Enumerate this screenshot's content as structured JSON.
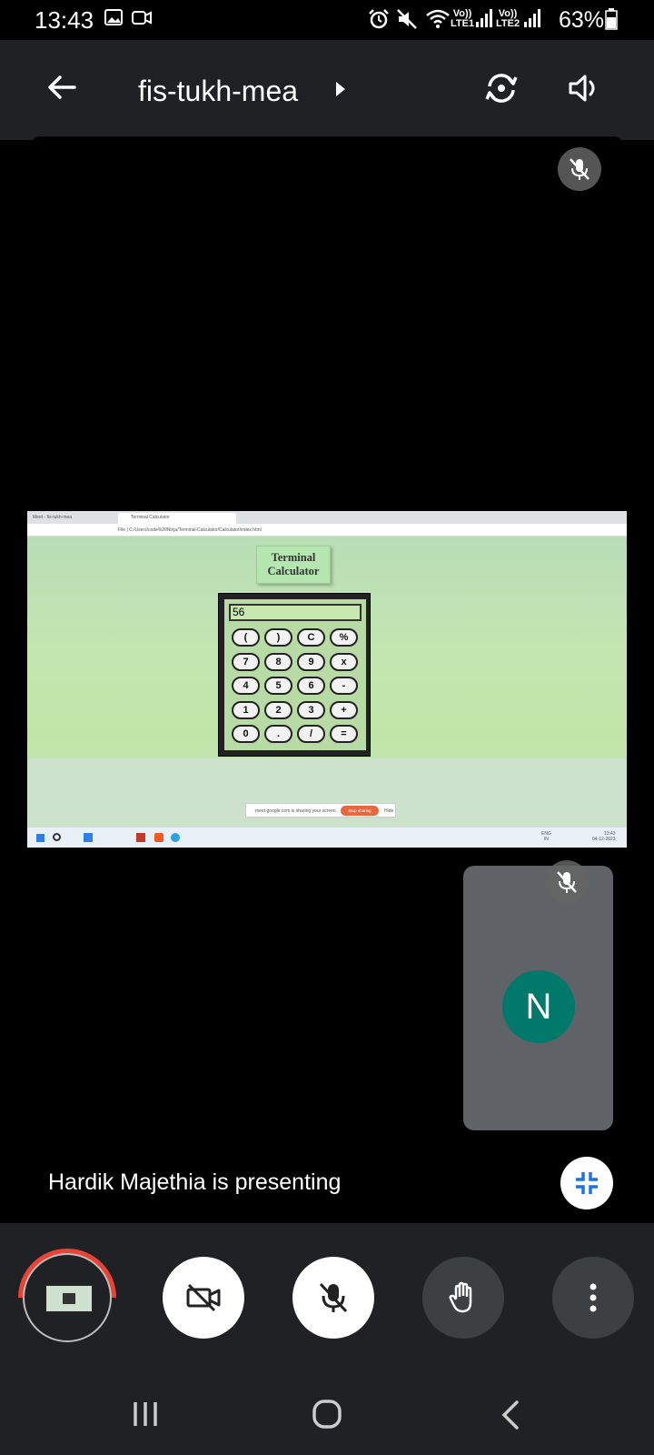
{
  "status_bar": {
    "time": "13:43",
    "battery": "63%",
    "sim1_label": "Vo))\nLTE1",
    "sim2_label": "Vo))\nLTE2",
    "icons": [
      "gallery-icon",
      "video-call-icon",
      "alarm-icon",
      "mute-icon",
      "wifi-icon",
      "signal-icon",
      "battery-icon"
    ]
  },
  "top_bar": {
    "meeting_code": "fis-tukh-mea",
    "icons": [
      "back-arrow-icon",
      "chevron-right-icon",
      "switch-camera-icon",
      "speaker-icon"
    ]
  },
  "shared_screen": {
    "browser": {
      "tab1": "Meet - fis-tukh-mea",
      "tab2": "Terminal Calculator",
      "address": "File | C:/Users/code%20Ninja/Terminal-Calculator/Calculator/index.html"
    },
    "calculator": {
      "title_line1": "Terminal",
      "title_line2": "Calculator",
      "display": "56",
      "keys": [
        [
          "(",
          ")",
          "C",
          "%"
        ],
        [
          "7",
          "8",
          "9",
          "x"
        ],
        [
          "4",
          "5",
          "6",
          "-"
        ],
        [
          "1",
          "2",
          "3",
          "+"
        ],
        [
          "0",
          ".",
          "/",
          "="
        ]
      ]
    },
    "banner": {
      "message": "meet.google.com is sharing your screen.",
      "stop_label": "Stop sharing",
      "hide_label": "Hide"
    },
    "taskbar": {
      "lang_line1": "ENG",
      "lang_line2": "IN",
      "clock_time": "13:43",
      "clock_date": "04-12-2023"
    }
  },
  "self_tile": {
    "avatar_initial": "N"
  },
  "presenting_text": "Hardik Majethia is presenting",
  "controls": [
    "screen-share-preview",
    "camera-off-button",
    "mic-off-button",
    "raise-hand-button",
    "more-options-button"
  ],
  "colors": {
    "background": "#202124",
    "stage": "#000000",
    "avatar": "#00796B",
    "tile": "#5F6368",
    "share_indicator": "#EA4335",
    "stop_sharing": "#E8683E"
  }
}
